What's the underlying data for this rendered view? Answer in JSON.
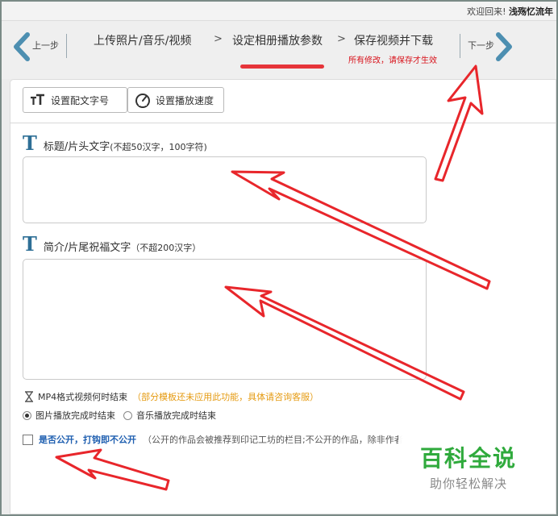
{
  "header": {
    "welcome_text": "欢迎回来!",
    "username": "浅殇忆流年"
  },
  "steps": {
    "prev_label": "上一步",
    "next_label": "下一步",
    "items": [
      {
        "label": "上传照片/音乐/视频",
        "active": false
      },
      {
        "label": "设定相册播放参数",
        "active": true
      },
      {
        "label": "保存视频并下载",
        "active": false
      }
    ],
    "separator": ">",
    "save_note": "所有修改，请保存才生效"
  },
  "toolbar": {
    "font_button": "设置配文字号",
    "speed_button": "设置播放速度"
  },
  "fields": {
    "title": {
      "icon": "T",
      "label": "标题/片头文字",
      "hint": "(不超50汉字，100字符)",
      "value": ""
    },
    "intro": {
      "icon": "T",
      "label": "简介/片尾祝福文字",
      "hint": "（不超200汉字）",
      "value": ""
    }
  },
  "mp4": {
    "label": "MP4格式视频何时结束",
    "tip": "（部分模板还未应用此功能，具体请咨询客服）",
    "options": [
      {
        "label": "图片播放完成时结束",
        "selected": true
      },
      {
        "label": "音乐播放完成时结束",
        "selected": false
      }
    ]
  },
  "public": {
    "label": "是否公开，打钩即不公开",
    "note": "（公开的作品会被推荐到印记工坊的栏目;不公开的作品，除非作者",
    "checked": false
  },
  "watermark": {
    "main": "百科全说",
    "sub": "助你轻松解决"
  },
  "colors": {
    "accent_red": "#e6353a",
    "nav_arrow": "#4d8fb1",
    "title_icon": "#2e6f96",
    "tip_orange": "#e59a10",
    "link_blue": "#1f5fb0",
    "watermark_green": "#2faa3c"
  }
}
